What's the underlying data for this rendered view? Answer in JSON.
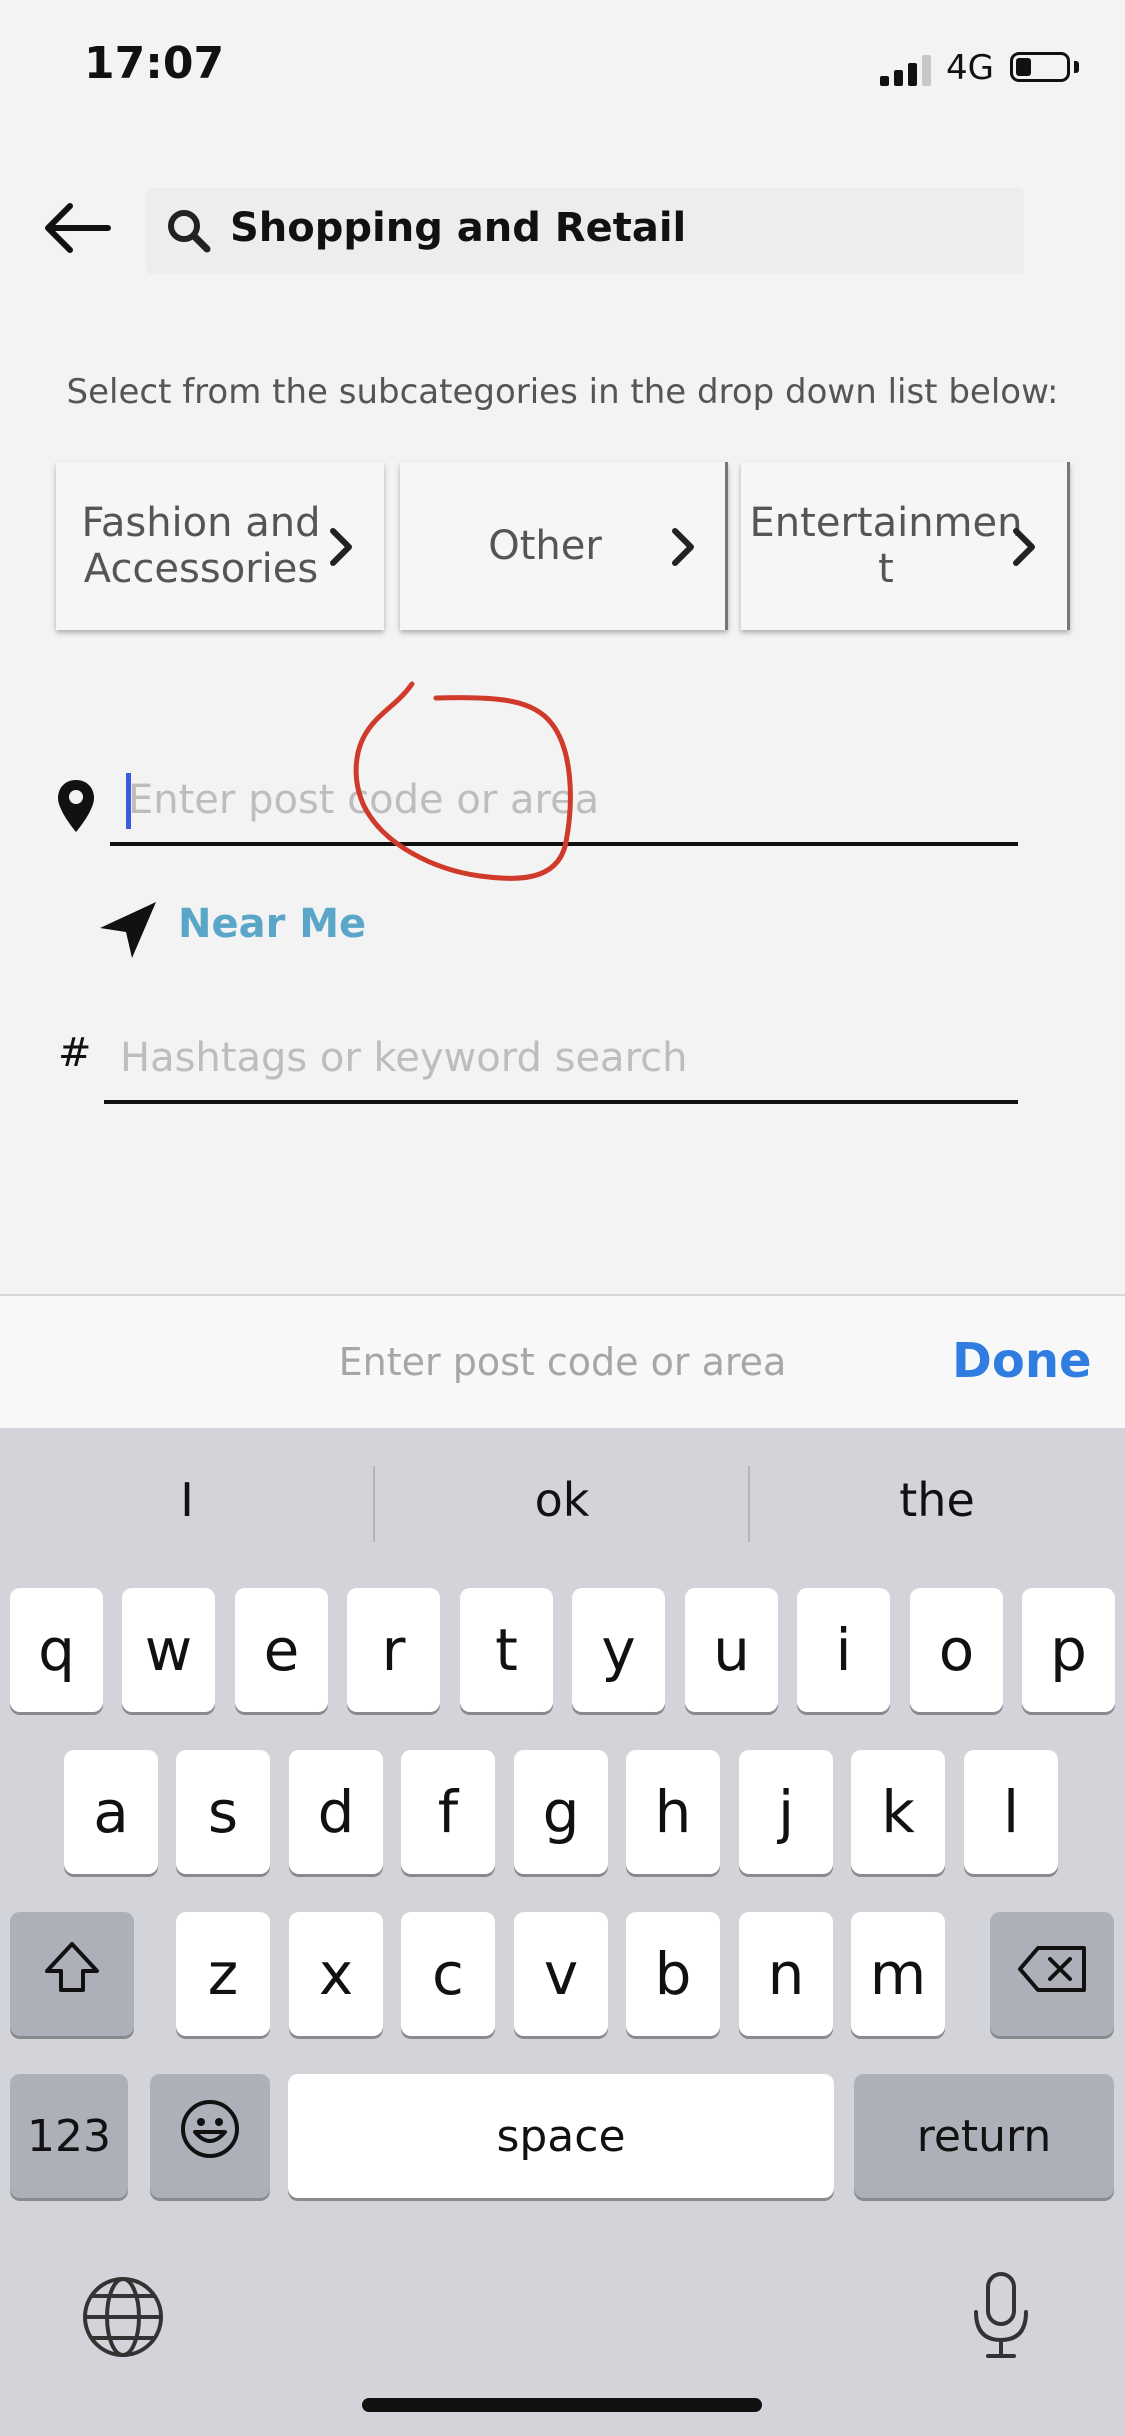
{
  "status": {
    "time": "17:07",
    "network": "4G"
  },
  "search": {
    "query": "Shopping and Retail"
  },
  "instruction": "Select from the subcategories in the drop down list below:",
  "categories": [
    {
      "label": "Fashion and Accessories"
    },
    {
      "label": "Other"
    },
    {
      "label": "Entertainmen t"
    }
  ],
  "location": {
    "placeholder": "Enter post code  or area",
    "near_me_label": "Near Me"
  },
  "hashtags": {
    "symbol": "#",
    "placeholder": "Hashtags or keyword search"
  },
  "accessory": {
    "text": "Enter post code  or area",
    "done_label": "Done"
  },
  "keyboard": {
    "suggestions": [
      "I",
      "ok",
      "the"
    ],
    "row1": [
      "q",
      "w",
      "e",
      "r",
      "t",
      "y",
      "u",
      "i",
      "o",
      "p"
    ],
    "row2": [
      "a",
      "s",
      "d",
      "f",
      "g",
      "h",
      "j",
      "k",
      "l"
    ],
    "row3": [
      "z",
      "x",
      "c",
      "v",
      "b",
      "n",
      "m"
    ],
    "numbers_label": "123",
    "space_label": "space",
    "return_label": "return"
  },
  "colors": {
    "accent": "#2f7de1",
    "near_me": "#5aa6c9",
    "annotation": "#d03a2a"
  }
}
